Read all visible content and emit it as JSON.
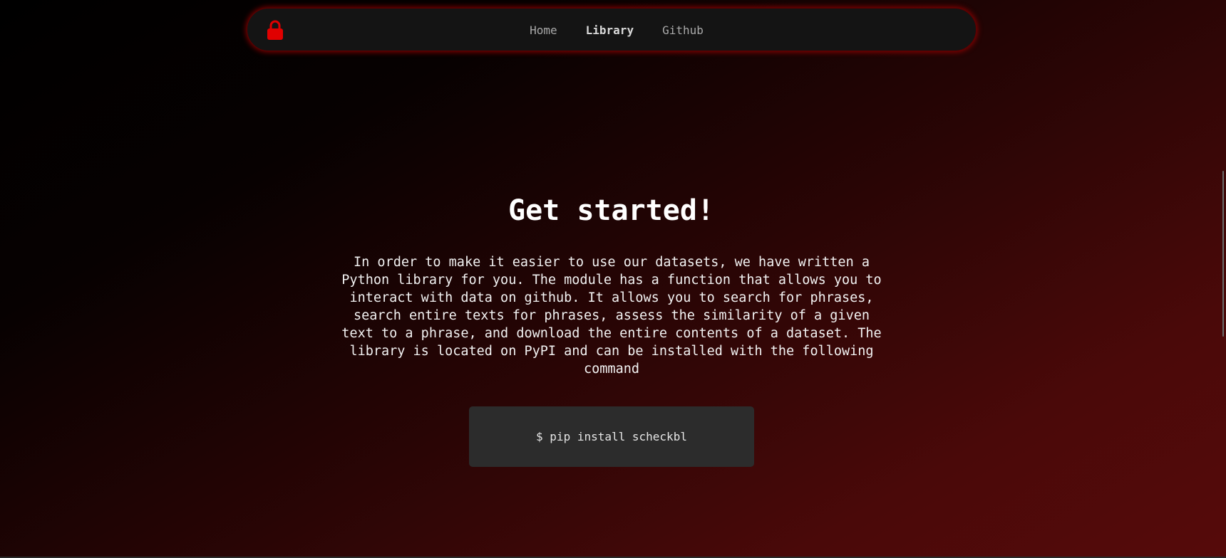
{
  "nav": {
    "logo_icon": "lock-icon",
    "accent_color": "#e00000",
    "links": [
      {
        "label": "Home",
        "active": false
      },
      {
        "label": "Library",
        "active": true
      },
      {
        "label": "Github",
        "active": false
      }
    ]
  },
  "hero": {
    "title": "Get started!",
    "description": "In order to make it easier to use our datasets, we have written a Python library for you. The module has a function that allows you to interact with data on github. It allows you to search for phrases, search entire texts for phrases, assess the similarity of a given text to a phrase, and download the entire contents of a dataset. The library is located on PyPI and can be installed with the following command",
    "command": "$ pip install scheckbl"
  }
}
